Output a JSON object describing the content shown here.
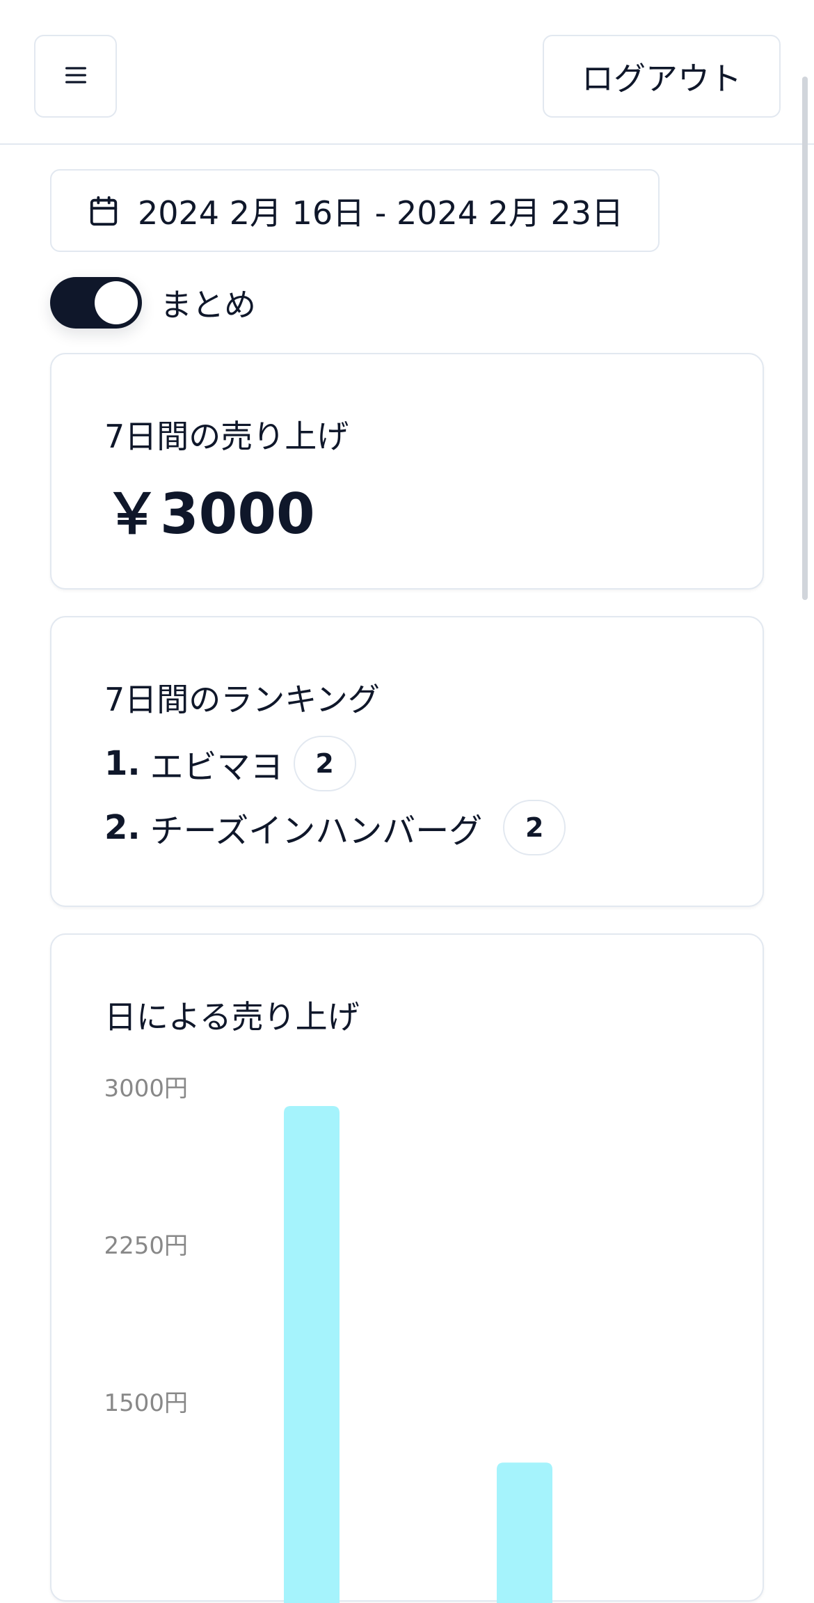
{
  "header": {
    "menu_icon": "hamburger-menu-icon",
    "logout_label": "ログアウト"
  },
  "date_range": {
    "icon": "calendar-icon",
    "label": "2024 2月 16日 - 2024 2月 23日"
  },
  "summary_toggle": {
    "label": "まとめ",
    "checked": true
  },
  "sales_card": {
    "title": "7日間の売り上げ",
    "value": "￥3000"
  },
  "ranking_card": {
    "title": "7日間のランキング",
    "items": [
      {
        "rank": "1.",
        "name": "エビマヨ",
        "count": "2"
      },
      {
        "rank": "2.",
        "name": "チーズインハンバーグ",
        "count": "2"
      }
    ]
  },
  "daily_chart_card": {
    "title": "日による売り上げ"
  },
  "colors": {
    "bar": "#a5f3fc",
    "primary": "#0f172a",
    "border": "#e2e8f0"
  },
  "chart_data": {
    "type": "bar",
    "title": "日による売り上げ",
    "ytick_labels": [
      "3000円",
      "2250円",
      "1500円"
    ],
    "yticks": [
      3000,
      2250,
      1500
    ],
    "values": [
      3000,
      1300
    ],
    "grid": false
  }
}
